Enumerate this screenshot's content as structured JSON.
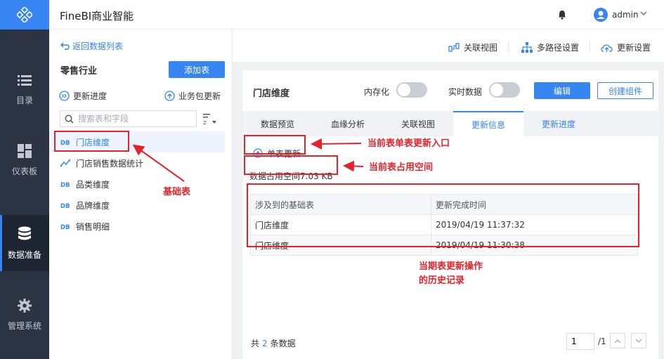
{
  "header": {
    "app_title": "FineBI商业智能",
    "user_name": "admin"
  },
  "rail": {
    "items": [
      {
        "label": "目录",
        "icon": "list-icon"
      },
      {
        "label": "仪表板",
        "icon": "dashboard-icon"
      },
      {
        "label": "数据准备",
        "icon": "database-icon",
        "active": true
      },
      {
        "label": "管理系统",
        "icon": "gear-icon"
      }
    ]
  },
  "tree": {
    "back_label": "返回数据列表",
    "package_title": "零售行业",
    "add_table_label": "添加表",
    "update_progress_label": "更新进度",
    "package_update_label": "业务包更新",
    "search_placeholder": "搜索表和字段",
    "items": [
      {
        "label": "门店维度",
        "type": "DB",
        "selected": true
      },
      {
        "label": "门店销售数据统计",
        "type": "analysis"
      },
      {
        "label": "品类维度",
        "type": "DB"
      },
      {
        "label": "品牌维度",
        "type": "DB"
      },
      {
        "label": "销售明细",
        "type": "DB"
      }
    ]
  },
  "topbar": {
    "relation_view_label": "关联视图",
    "multipath_label": "多路径设置",
    "update_settings_label": "更新设置"
  },
  "table_panel": {
    "table_name": "门店维度",
    "in_memory_label": "内存化",
    "realtime_label": "实时数据",
    "in_memory_on": false,
    "realtime_on": false,
    "edit_label": "编辑",
    "create_component_label": "创建组件",
    "tabs": [
      {
        "label": "数据预览"
      },
      {
        "label": "血缘分析"
      },
      {
        "label": "关联视图"
      },
      {
        "label": "更新信息",
        "active": true
      },
      {
        "label": "更新进度"
      }
    ],
    "single_update_label": "单表更新",
    "space_used_text": "数据占用空间7.03 KB",
    "history": {
      "headers": [
        "涉及到的基础表",
        "更新完成时间"
      ],
      "rows": [
        [
          "门店维度",
          "2019/04/19 11:37:32"
        ],
        [
          "门店维度",
          "2019/04/19 11:30:38"
        ]
      ]
    },
    "footer": {
      "total_prefix": "共",
      "total_count": "2",
      "total_suffix": "条数据",
      "page_value": "1",
      "page_total": "/1"
    }
  },
  "annotations": {
    "base_table": "基础表",
    "single_update_entry": "当前表单表更新入口",
    "space_used": "当前表占用空间",
    "history_line1": "当期表更新操作",
    "history_line2": "的历史记录"
  },
  "colors": {
    "accent": "#3685f2",
    "rail_bg": "#2c3444",
    "annotation_red": "#e4232b"
  }
}
